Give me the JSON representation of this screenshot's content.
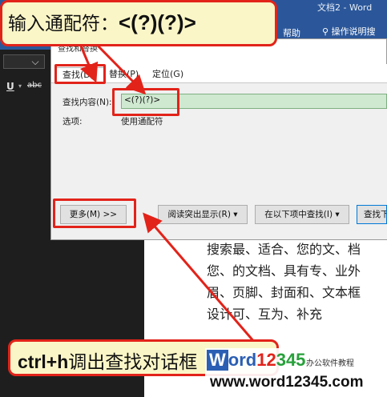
{
  "word": {
    "title": "文档2 - Word",
    "menu_help": "帮助",
    "tell_me": "操作说明搜",
    "format_underline": "U",
    "format_strike": "abc"
  },
  "dialog": {
    "title": "查找和替换",
    "tabs": [
      {
        "label": "查找(D)"
      },
      {
        "label": "替换(P)"
      },
      {
        "label": "定位(G)"
      }
    ],
    "find_label": "查找内容(N):",
    "find_value": "<(?)(?)>",
    "options_label": "选项:",
    "options_value": "使用通配符",
    "buttons": {
      "more": "更多(M) >>",
      "reading_highlight": "阅读突出显示(R) ▾",
      "find_in": "在以下项中查找(I) ▾",
      "find_next": "查找下一处(F)"
    }
  },
  "document": {
    "lines": [
      "搜索最、适合、您的文、档",
      "您、的文档、具有专、业外",
      "眉、页脚、封面和、文本框",
      "设计可、互为、补充"
    ]
  },
  "annotations": {
    "top_callout_prefix": "输入通配符：",
    "top_callout_code": "<(?)(?)>",
    "bottom_callout_code": "ctrl+h",
    "bottom_callout_text": "调出查找对话框",
    "highlight_color": "#e2231a",
    "callout_bg": "#fbf6c7"
  },
  "watermark": {
    "logo_w": "W",
    "logo_ord": "ord",
    "logo_12": "12",
    "logo_345": "345",
    "slogan": "办公软件教程",
    "url": "www.word12345.com"
  },
  "colors": {
    "word_blue": "#2b579a",
    "input_highlight": "#cfe8d0"
  }
}
